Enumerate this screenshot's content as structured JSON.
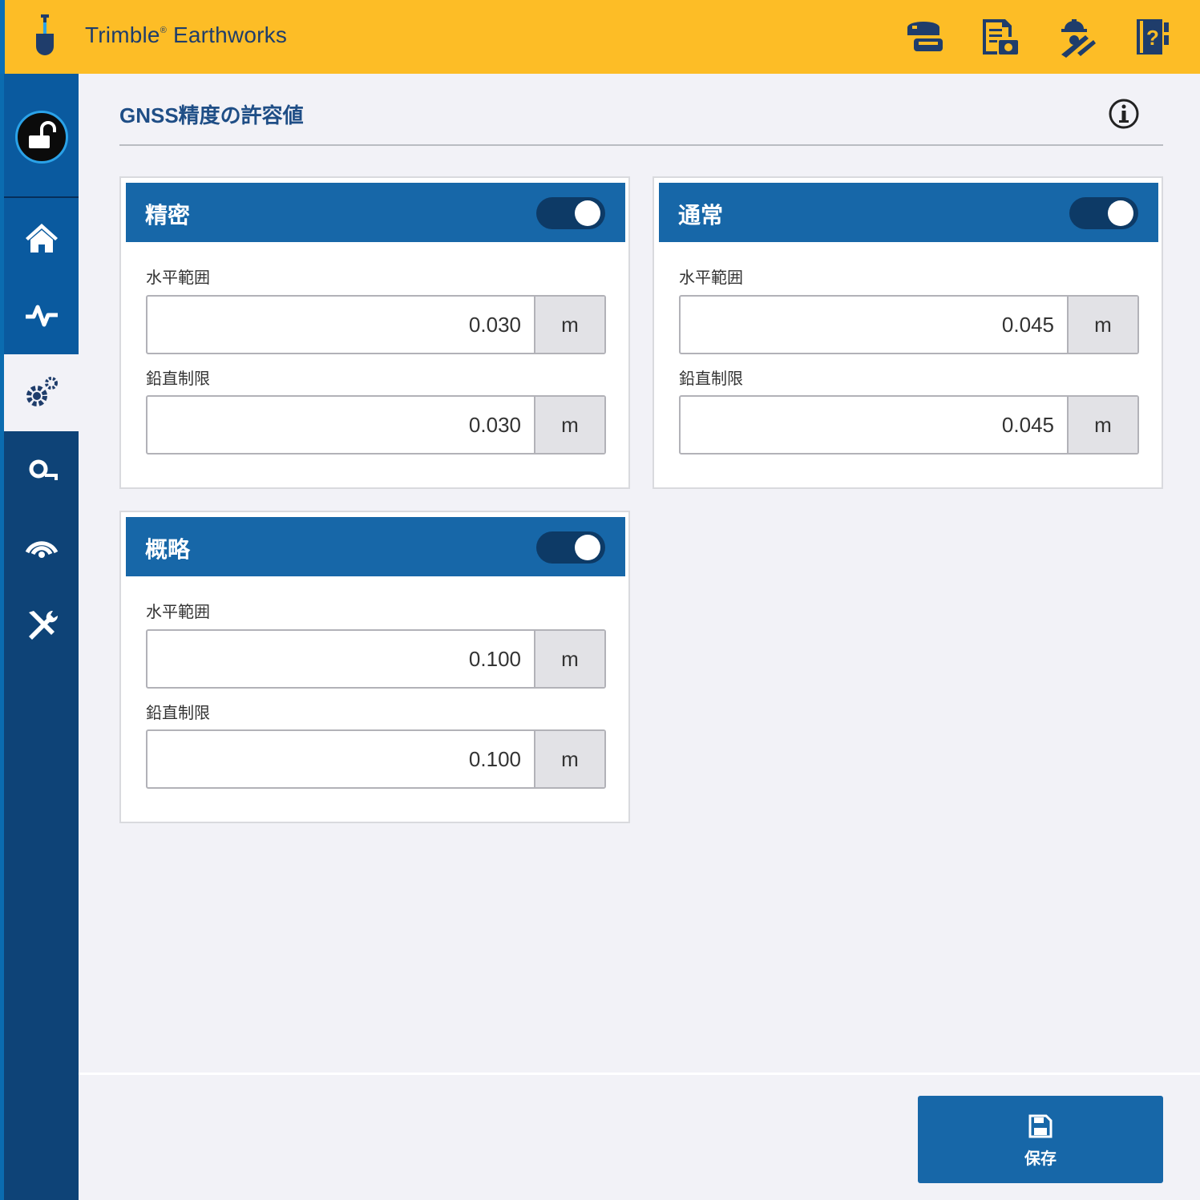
{
  "app": {
    "title": "Trimble",
    "title_mark": "®",
    "title_suffix": " Earthworks"
  },
  "header": {
    "icons": [
      "gnss-receiver-icon",
      "report-camera-icon",
      "operator-tools-icon",
      "help-book-icon"
    ]
  },
  "sidebar": {
    "items": [
      {
        "name": "lock-icon"
      },
      {
        "name": "home-icon"
      },
      {
        "name": "activity-icon"
      },
      {
        "name": "settings-icon",
        "active": true
      },
      {
        "name": "search-key-icon"
      },
      {
        "name": "wireless-icon"
      },
      {
        "name": "tools-icon"
      }
    ]
  },
  "page": {
    "title": "GNSS精度の許容値"
  },
  "cards": [
    {
      "title": "精密",
      "enabled": true,
      "horizontal": {
        "label": "水平範囲",
        "value": "0.030",
        "unit": "m"
      },
      "vertical": {
        "label": "鉛直制限",
        "value": "0.030",
        "unit": "m"
      }
    },
    {
      "title": "通常",
      "enabled": true,
      "horizontal": {
        "label": "水平範囲",
        "value": "0.045",
        "unit": "m"
      },
      "vertical": {
        "label": "鉛直制限",
        "value": "0.045",
        "unit": "m"
      }
    },
    {
      "title": "概略",
      "enabled": true,
      "horizontal": {
        "label": "水平範囲",
        "value": "0.100",
        "unit": "m"
      },
      "vertical": {
        "label": "鉛直制限",
        "value": "0.100",
        "unit": "m"
      }
    }
  ],
  "footer": {
    "save_label": "保存"
  },
  "colors": {
    "header": "#fdbd26",
    "sidebar": "#0e4377",
    "accent": "#1767a8",
    "toggle_on": "#0d3a66"
  }
}
